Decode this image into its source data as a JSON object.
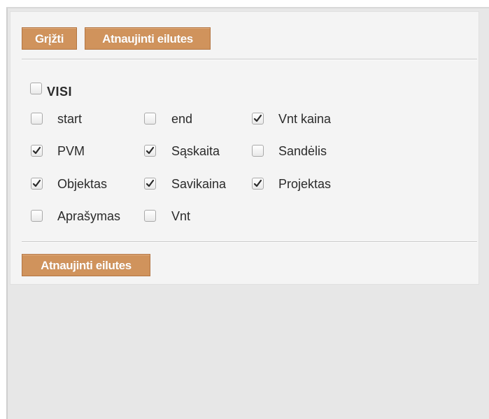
{
  "toolbar": {
    "back_label": "Grįžti",
    "refresh_label": "Atnaujinti eilutes"
  },
  "select_all": {
    "label": "VISI",
    "checked": false
  },
  "columns": [
    {
      "label": "start",
      "checked": false
    },
    {
      "label": "end",
      "checked": false
    },
    {
      "label": "Vnt kaina",
      "checked": true
    },
    {
      "label": "PVM",
      "checked": true
    },
    {
      "label": "Sąskaita",
      "checked": true
    },
    {
      "label": "Sandėlis",
      "checked": false
    },
    {
      "label": "Objektas",
      "checked": true
    },
    {
      "label": "Savikaina",
      "checked": true
    },
    {
      "label": "Projektas",
      "checked": true
    },
    {
      "label": "Aprašymas",
      "checked": false
    },
    {
      "label": "Vnt",
      "checked": false
    }
  ],
  "footer": {
    "refresh_label": "Atnaujinti eilutes"
  }
}
